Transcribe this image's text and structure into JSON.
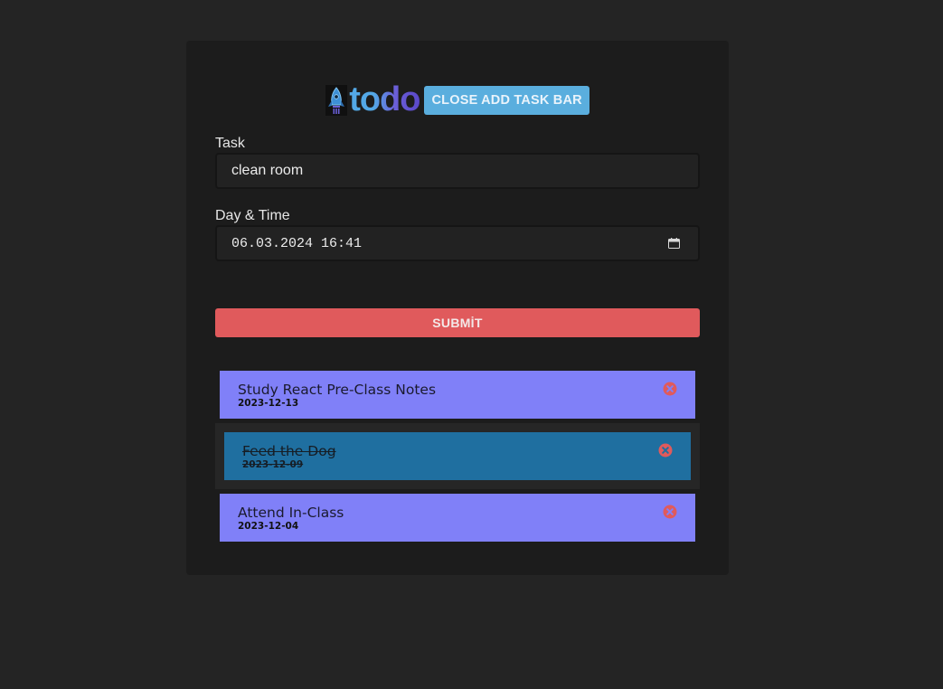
{
  "header": {
    "logo_text": "todo",
    "toggle_label": "CLOSE ADD TASK BAR"
  },
  "form": {
    "task_label": "Task",
    "task_value": "clean room",
    "datetime_label": "Day & Time",
    "datetime_value": "06.03.2024 16:41",
    "submit_label": "SUBMİT"
  },
  "tasks": [
    {
      "title": "Study React Pre-Class Notes",
      "date": "2023-12-13",
      "done": false
    },
    {
      "title": "Feed the Dog",
      "date": "2023-12-09",
      "done": true
    },
    {
      "title": "Attend In-Class",
      "date": "2023-12-04",
      "done": false
    }
  ],
  "colors": {
    "background": "#242424",
    "panel": "#1c1c1c",
    "toggle_button": "#5aaede",
    "submit_button": "#e05a5c",
    "task_pending": "#8080f8",
    "task_done": "#1f6fa0",
    "delete_icon": "#e05a5c"
  },
  "icons": {
    "logo": "rocket-icon",
    "datetime": "calendar-icon",
    "delete": "close-circle-icon"
  }
}
